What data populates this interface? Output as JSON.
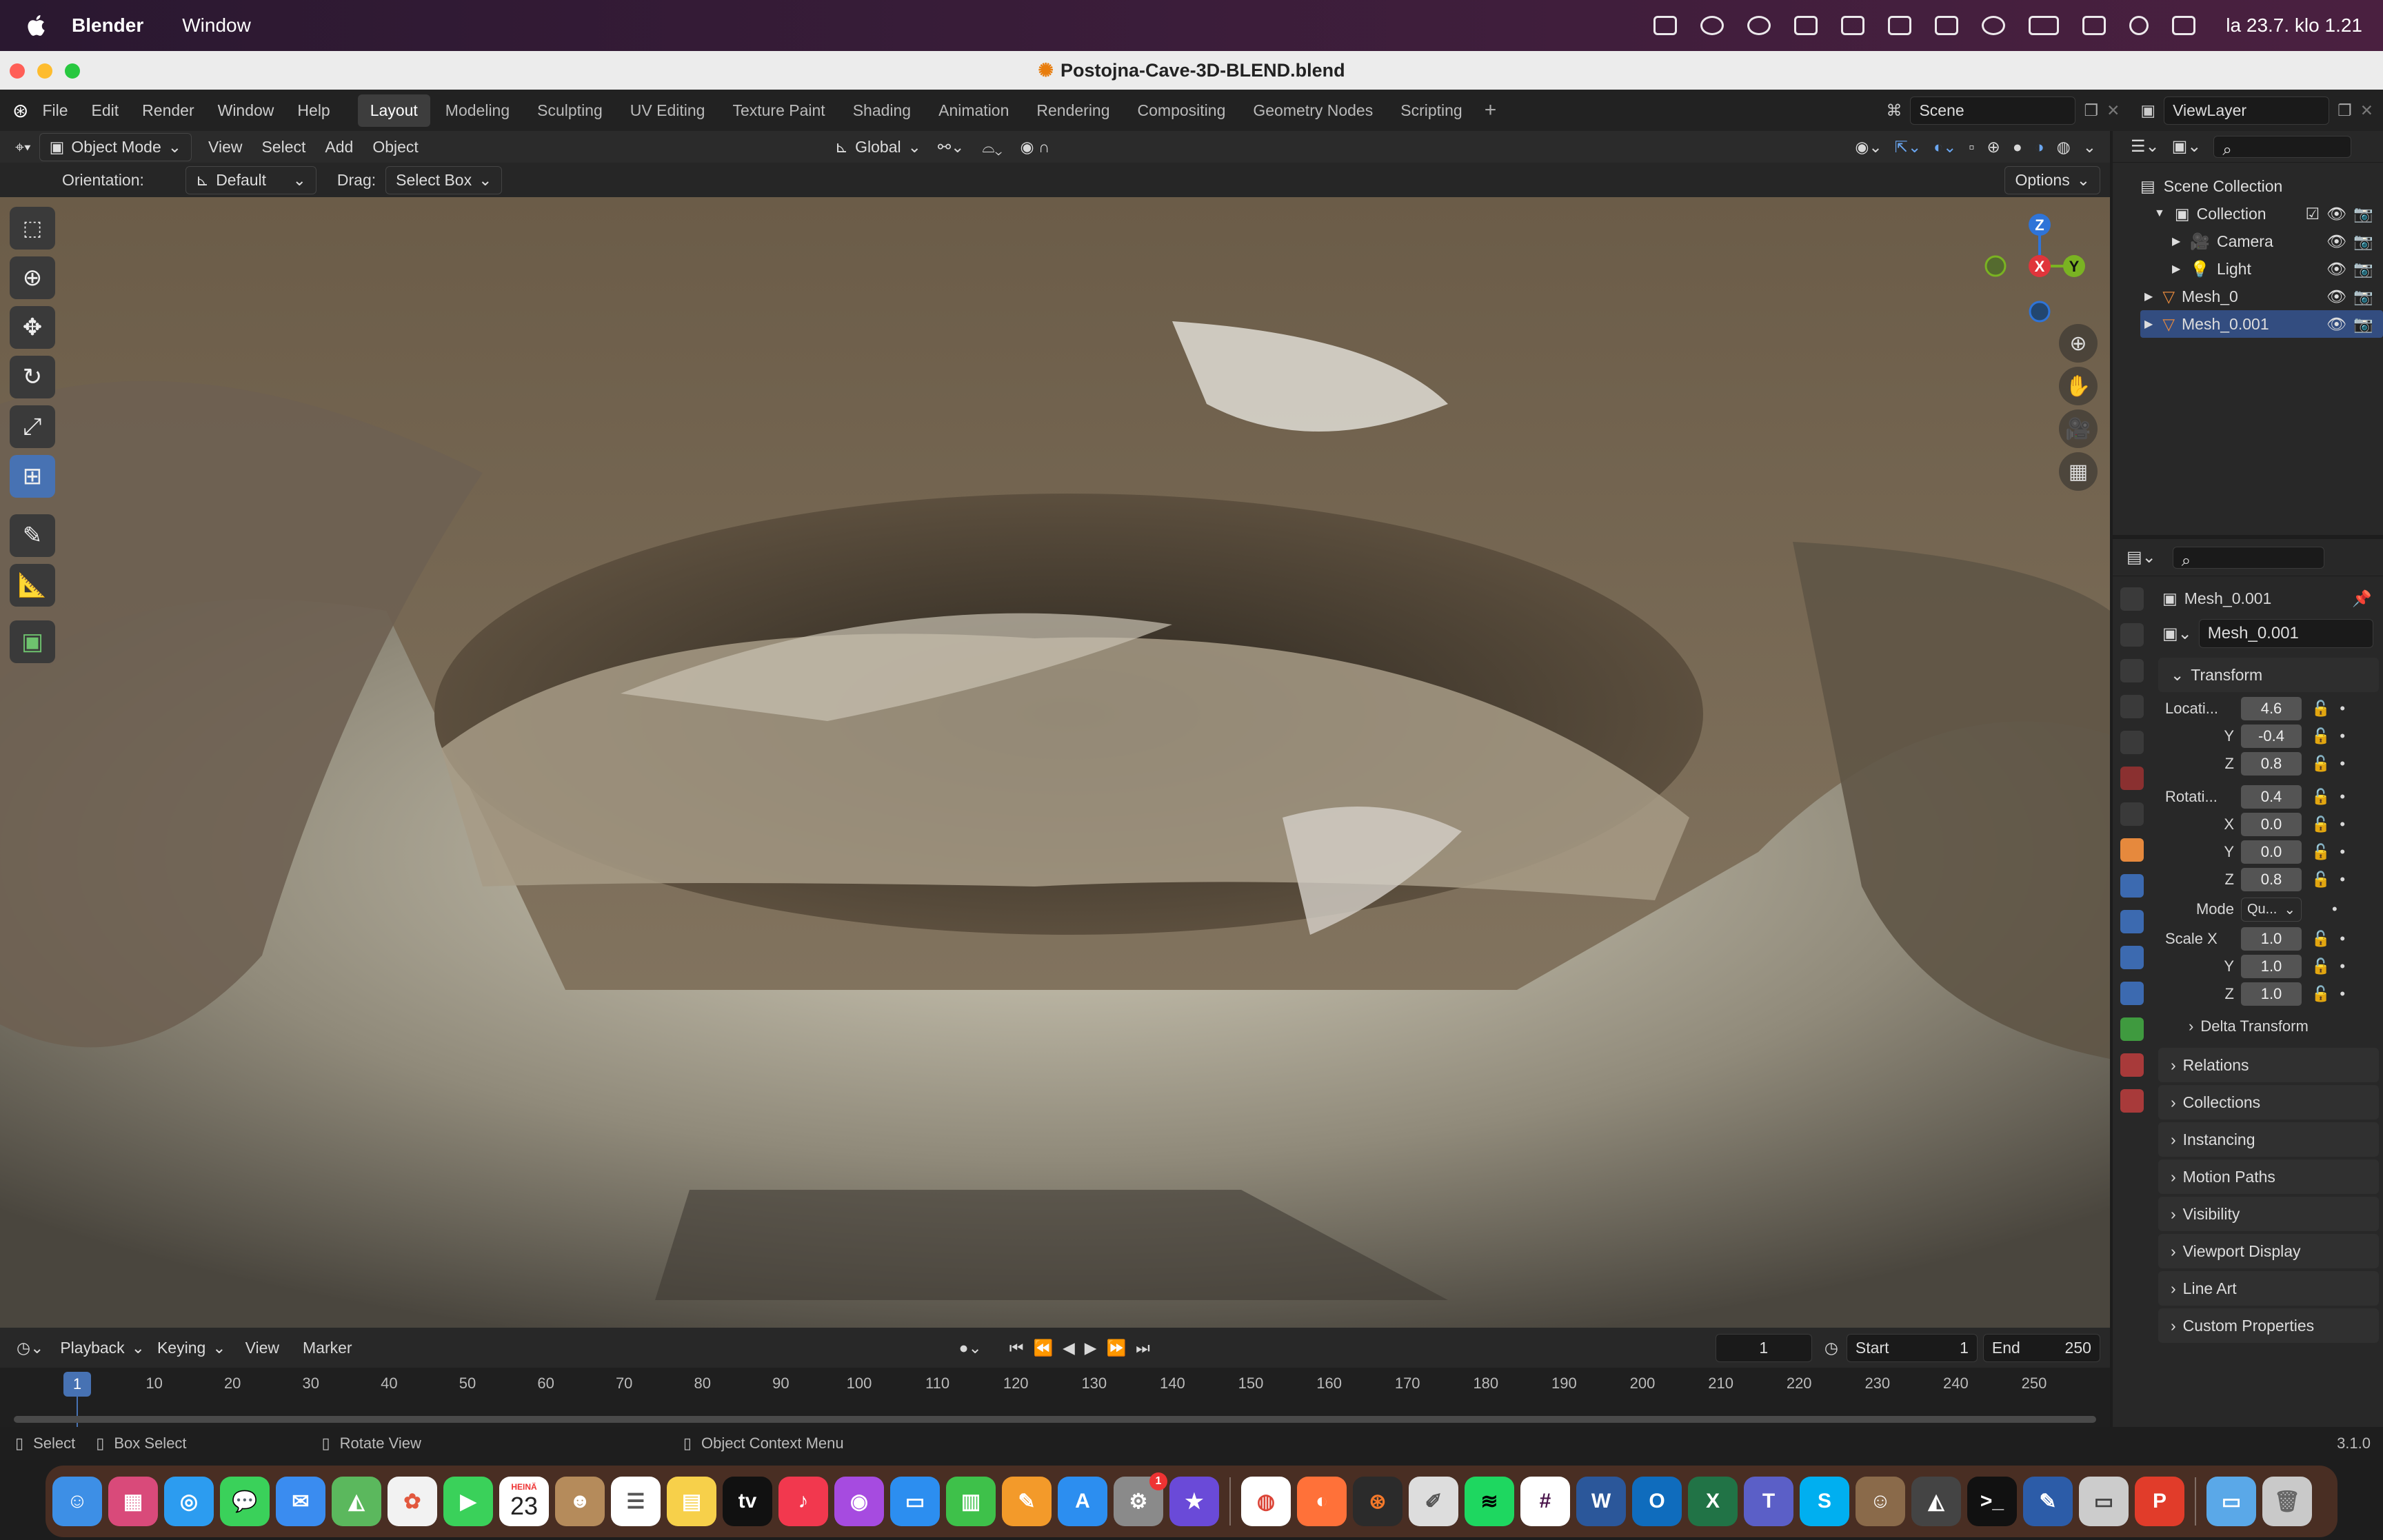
{
  "menubar": {
    "app": "Blender",
    "items": [
      "Window"
    ],
    "clock": "la 23.7. klo 1.21"
  },
  "window": {
    "title": "Postojna-Cave-3D-BLEND.blend"
  },
  "topbar": {
    "menus": [
      "File",
      "Edit",
      "Render",
      "Window",
      "Help"
    ],
    "workspaces": [
      "Layout",
      "Modeling",
      "Sculpting",
      "UV Editing",
      "Texture Paint",
      "Shading",
      "Animation",
      "Rendering",
      "Compositing",
      "Geometry Nodes",
      "Scripting"
    ],
    "scene": "Scene",
    "view_layer": "ViewLayer"
  },
  "viewport_header": {
    "mode": "Object Mode",
    "menus": [
      "View",
      "Select",
      "Add",
      "Object"
    ],
    "transform_orientation": "Global"
  },
  "tool_settings": {
    "orientation_label": "Orientation:",
    "orientation": "Default",
    "drag_label": "Drag:",
    "drag": "Select Box",
    "options": "Options"
  },
  "gizmo": {
    "x": "X",
    "y": "Y",
    "z": "Z"
  },
  "outliner": {
    "root": "Scene Collection",
    "items": [
      {
        "label": "Collection"
      },
      {
        "label": "Camera"
      },
      {
        "label": "Light"
      },
      {
        "label": "Mesh_0"
      },
      {
        "label": "Mesh_0.001"
      }
    ]
  },
  "properties": {
    "object_name": "Mesh_0.001",
    "data_name": "Mesh_0.001",
    "transform_label": "Transform",
    "location_label": "Locati...",
    "location": [
      "4.6",
      "-0.4",
      "0.8"
    ],
    "rotation_label": "Rotati...",
    "rotation": [
      "0.4",
      "0.0",
      "0.0",
      "0.8"
    ],
    "axis": [
      "Y",
      "Z",
      "X",
      "Y",
      "Z"
    ],
    "mode_label": "Mode",
    "mode": "Qu...",
    "scale_label": "Scale X",
    "scale": [
      "1.0",
      "1.0",
      "1.0"
    ],
    "delta": "Delta Transform",
    "sections": [
      "Relations",
      "Collections",
      "Instancing",
      "Motion Paths",
      "Visibility",
      "Viewport Display",
      "Line Art",
      "Custom Properties"
    ]
  },
  "timeline": {
    "menus": [
      "Playback",
      "Keying",
      "View",
      "Marker"
    ],
    "current_frame": "1",
    "start_label": "Start",
    "start": "1",
    "end_label": "End",
    "end": "250",
    "ticks": [
      "1",
      "10",
      "20",
      "30",
      "40",
      "50",
      "60",
      "70",
      "80",
      "90",
      "100",
      "110",
      "120",
      "130",
      "140",
      "150",
      "160",
      "170",
      "180",
      "190",
      "200",
      "210",
      "220",
      "230",
      "240",
      "250"
    ]
  },
  "statusbar": {
    "select": "Select",
    "box_select": "Box Select",
    "rotate": "Rotate View",
    "context": "Object Context Menu",
    "version": "3.1.0"
  },
  "dock": {
    "calendar_month": "HEINÄ",
    "calendar_day": "23",
    "badge": "1"
  },
  "colors": {
    "accent": "#4772b3",
    "x_axis": "#e0353b",
    "y_axis": "#7ab322",
    "z_axis": "#2f74d8",
    "dock_bg": "#6e3c28"
  }
}
